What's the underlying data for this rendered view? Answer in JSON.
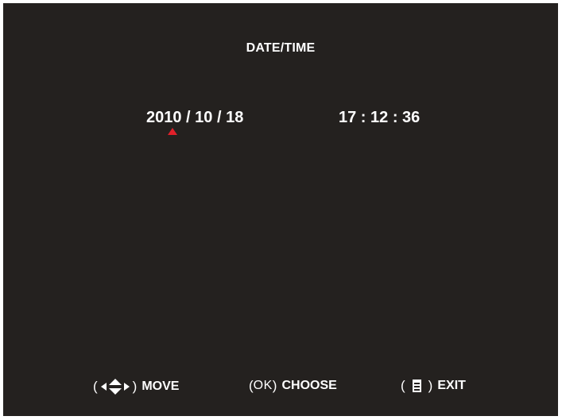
{
  "screen": {
    "title": "DATE/TIME",
    "date": "2010 / 10 / 18",
    "time": "17 : 12 : 36",
    "cursor_color": "#e0202a",
    "background_color": "#24211f"
  },
  "hints": {
    "move": {
      "open": "(",
      "close": ")",
      "label": "MOVE",
      "icons": [
        "left-arrow-icon",
        "up-down-arrows-icon",
        "right-arrow-icon"
      ]
    },
    "choose": {
      "open": "(",
      "key": "OK",
      "close": ")",
      "label": "CHOOSE"
    },
    "exit": {
      "open": "(",
      "close": ")",
      "label": "EXIT",
      "icons": [
        "menu-icon"
      ]
    }
  }
}
